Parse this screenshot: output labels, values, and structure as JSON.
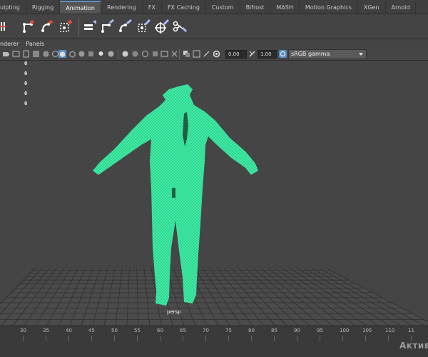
{
  "shelf": {
    "tabs": [
      "ulpting",
      "Rigging",
      "Animation",
      "Rendering",
      "FX",
      "FX Caching",
      "Custom",
      "Bifrost",
      "MASH",
      "Motion Graphics",
      "XGen",
      "Arnold"
    ],
    "active_tab_index": 2
  },
  "panel_menu": {
    "items": [
      "nderer",
      "Panels"
    ]
  },
  "panel_toolbar": {
    "exposure_value": "0.00",
    "gamma_value": "1.00",
    "color_space": "sRGB gamma"
  },
  "viewport": {
    "hud_values": [
      "0",
      "0",
      "0",
      "0",
      "0"
    ],
    "camera_label": "persp",
    "mesh_color": "#3ff0a6",
    "background_color": "#454545"
  },
  "time_slider": {
    "frame_ticks": [
      "30",
      "35",
      "40",
      "45",
      "50",
      "55",
      "60",
      "65",
      "70",
      "75",
      "80",
      "85",
      "90",
      "95",
      "100",
      "105",
      "110",
      "11"
    ]
  },
  "watermark": {
    "text": "Активa"
  }
}
